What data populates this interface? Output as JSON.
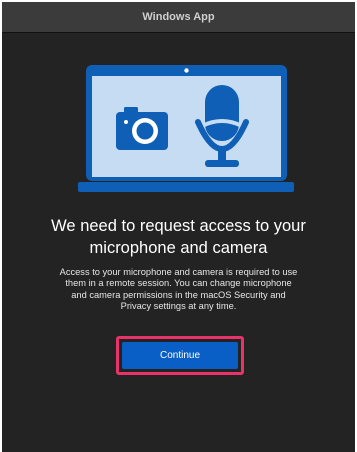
{
  "window": {
    "title": "Windows App"
  },
  "dialog": {
    "heading_line1": "We need to request access to your",
    "heading_line2": "microphone and camera",
    "body_lines": [
      "Access to your microphone and camera is required to use",
      "them in a remote session. You can change microphone",
      "and camera permissions in the macOS Security and",
      "Privacy settings at any time."
    ],
    "continue_label": "Continue"
  },
  "colors": {
    "window_background": "#232323",
    "titlebar": "#3b3b3b",
    "laptop_frame": "#0e5fb5",
    "laptop_screen": "#c6dcf2",
    "button_primary": "#0a5fc6",
    "highlight_outline": "#e8336a"
  },
  "icons": {
    "illustration": "laptop-icon",
    "camera": "camera-icon",
    "microphone": "microphone-icon"
  }
}
